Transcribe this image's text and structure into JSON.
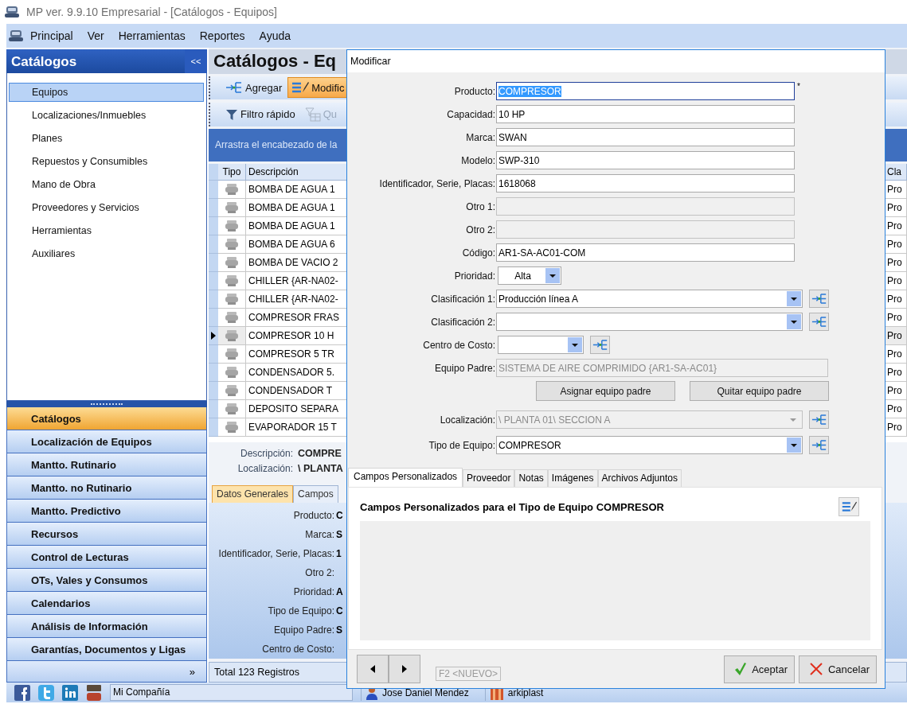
{
  "window": {
    "title": "MP ver. 9.9.10 Empresarial - [Catálogos - Equipos]"
  },
  "menu": [
    "Principal",
    "Ver",
    "Herramientas",
    "Reportes",
    "Ayuda"
  ],
  "sidebar": {
    "title": "Catálogos",
    "collapse": "<<",
    "items": [
      {
        "label": "Equipos",
        "selected": true
      },
      {
        "label": "Localizaciones/Inmuebles",
        "selected": false
      },
      {
        "label": "Planes",
        "selected": false
      },
      {
        "label": "Repuestos y Consumibles",
        "selected": false
      },
      {
        "label": "Mano de Obra",
        "selected": false
      },
      {
        "label": "Proveedores y Servicios",
        "selected": false
      },
      {
        "label": "Herramientas",
        "selected": false
      },
      {
        "label": "Auxiliares",
        "selected": false
      }
    ],
    "sections": [
      {
        "label": "Catálogos",
        "selected": true
      },
      {
        "label": "Localización de Equipos",
        "selected": false
      },
      {
        "label": "Mantto. Rutinario",
        "selected": false
      },
      {
        "label": "Mantto. no Rutinario",
        "selected": false
      },
      {
        "label": "Mantto. Predictivo",
        "selected": false
      },
      {
        "label": "Recursos",
        "selected": false
      },
      {
        "label": "Control de Lecturas",
        "selected": false
      },
      {
        "label": "OTs, Vales y Consumos",
        "selected": false
      },
      {
        "label": "Calendarios",
        "selected": false
      },
      {
        "label": "Análisis de Información",
        "selected": false
      },
      {
        "label": "Garantías, Documentos y Ligas",
        "selected": false
      }
    ],
    "more": "»"
  },
  "catalog": {
    "title": "Catálogos - Eq",
    "toolbar": [
      {
        "kind": "add",
        "label": "Agregar",
        "selected": false
      },
      {
        "kind": "edit",
        "label": "Modific",
        "selected": true
      }
    ],
    "filters": [
      {
        "kind": "filter",
        "label": "Filtro rápido",
        "disabled": false
      },
      {
        "kind": "clear",
        "label": "Qu",
        "disabled": true
      }
    ],
    "group_hint": "Arrastra el encabezado de la",
    "table": {
      "columns": [
        "Tipo",
        "Descripción",
        "Cla"
      ],
      "rows": [
        {
          "description": "BOMBA DE AGUA 1",
          "column_3": "Pro",
          "selected": false
        },
        {
          "description": "BOMBA DE AGUA 1",
          "column_3": "Pro",
          "selected": false
        },
        {
          "description": "BOMBA DE AGUA 1",
          "column_3": "Pro",
          "selected": false
        },
        {
          "description": "BOMBA DE AGUA 6",
          "column_3": "Pro",
          "selected": false
        },
        {
          "description": "BOMBA DE VACIO 2",
          "column_3": "Pro",
          "selected": false
        },
        {
          "description": "CHILLER {AR-NA02-",
          "column_3": "Pro",
          "selected": false
        },
        {
          "description": "CHILLER {AR-NA02-",
          "column_3": "Pro",
          "selected": false
        },
        {
          "description": "COMPRESOR  FRAS",
          "column_3": "Pro",
          "selected": false
        },
        {
          "description": "COMPRESOR 10 H",
          "column_3": "Pro",
          "selected": true
        },
        {
          "description": "COMPRESOR 5 TR",
          "column_3": "Pro",
          "selected": false
        },
        {
          "description": "CONDENSADOR 5.",
          "column_3": "Pro",
          "selected": false
        },
        {
          "description": "CONDENSADOR T",
          "column_3": "Pro",
          "selected": false
        },
        {
          "description": "DEPOSITO SEPARA",
          "column_3": "Pro",
          "selected": false
        },
        {
          "description": "EVAPORADOR 15 T",
          "column_3": "Pro",
          "selected": false
        }
      ]
    },
    "details": [
      {
        "label": "Descripción:",
        "value": "COMPRE"
      },
      {
        "label": "Localización:",
        "value": "\\ PLANTA"
      }
    ],
    "tabs": [
      {
        "label": "Datos Generales",
        "selected": true
      },
      {
        "label": "Campos",
        "selected": false
      }
    ],
    "fields": [
      {
        "label": "Producto:",
        "value": "C"
      },
      {
        "label": "Marca:",
        "value": "S"
      },
      {
        "label": "Identificador, Serie, Placas:",
        "value": "1"
      },
      {
        "label": "Otro 2:"
      },
      {
        "label": "Prioridad:",
        "value": "A"
      },
      {
        "label": "Tipo de Equipo:",
        "value": "C"
      },
      {
        "label": "Equipo Padre:",
        "value": "S"
      },
      {
        "label": "Centro de Costo:"
      }
    ],
    "footer": "Total 123 Registros"
  },
  "dialog": {
    "title": "Modificar",
    "fields": [
      {
        "kind": "text",
        "label": "Producto:",
        "value": "COMPRESOR",
        "mark": "*",
        "focused": true,
        "disabled": false
      },
      {
        "kind": "text",
        "label": "Capacidad:",
        "value": "10 HP",
        "focused": false,
        "disabled": false
      },
      {
        "kind": "text",
        "label": "Marca:",
        "value": "SWAN",
        "focused": false,
        "disabled": false
      },
      {
        "kind": "text",
        "label": "Modelo:",
        "value": "SWP-310",
        "focused": false,
        "disabled": false
      },
      {
        "kind": "text",
        "label": "Identificador, Serie, Placas:",
        "value": "1618068",
        "focused": false,
        "disabled": false
      },
      {
        "kind": "text",
        "label": "Otro 1:",
        "focused": false,
        "disabled": true
      },
      {
        "kind": "text",
        "label": "Otro 2:",
        "focused": false,
        "disabled": true
      },
      {
        "kind": "text",
        "label": "Código:",
        "value": "AR1-SA-AC01-COM",
        "focused": false,
        "disabled": false
      },
      {
        "kind": "small_combo",
        "label": "Prioridad:",
        "value": "Alta",
        "focused": false,
        "disabled": false,
        "add": false
      },
      {
        "kind": "combo",
        "label": "Clasificación 1:",
        "value": "Producción línea A",
        "focused": false,
        "disabled": false,
        "add": true
      },
      {
        "kind": "combo",
        "label": "Clasificación 2:",
        "focused": false,
        "disabled": false,
        "add": true
      },
      {
        "kind": "medium_combo",
        "label": "Centro de Costo:",
        "focused": false,
        "disabled": false,
        "add": true
      },
      {
        "kind": "parent",
        "label": "Equipo Padre:",
        "value": "SISTEMA DE AIRE COMPRIMIDO {AR1-SA-AC01}",
        "focused": false,
        "disabled": true
      },
      {
        "kind": "buttons",
        "buttons": [
          "Asignar equipo padre",
          "Quitar equipo padre"
        ]
      },
      {
        "kind": "combo",
        "label": "Localización:",
        "value": "\\ PLANTA 01\\ SECCION A",
        "focused": false,
        "disabled": true,
        "add": true
      },
      {
        "kind": "combo",
        "label": "Tipo de Equipo:",
        "value": "COMPRESOR",
        "focused": false,
        "disabled": false,
        "add": true
      }
    ],
    "tabs": [
      {
        "label": "Campos Personalizados",
        "selected": true
      },
      {
        "label": "Proveedor",
        "selected": false
      },
      {
        "label": "Notas",
        "selected": false
      },
      {
        "label": "Imágenes",
        "selected": false
      },
      {
        "label": "Archivos Adjuntos",
        "selected": false
      }
    ],
    "panel_heading": "Campos Personalizados para el Tipo de Equipo COMPRESOR",
    "new_label": "F2 <NUEVO>",
    "buttons": [
      {
        "kind": "ok",
        "label": "Aceptar"
      },
      {
        "kind": "cancel",
        "label": "Cancelar"
      }
    ]
  },
  "status_bar": {
    "company": "Mi Compañía",
    "user": "Jose Daniel Mendez",
    "database": "arkiplast"
  }
}
